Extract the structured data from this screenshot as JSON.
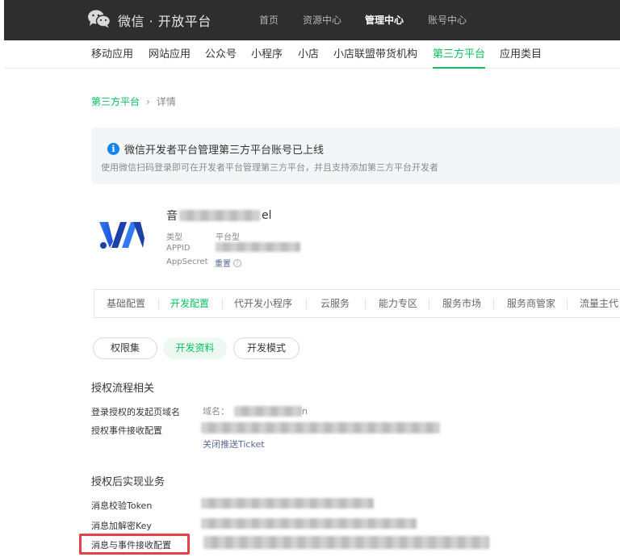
{
  "header": {
    "brand": "微信 · 开放平台",
    "nav": [
      "首页",
      "资源中心",
      "管理中心",
      "账号中心"
    ],
    "active_nav": "管理中心"
  },
  "subnav": {
    "items": [
      "移动应用",
      "网站应用",
      "公众号",
      "小程序",
      "小店",
      "小店联盟带货机构",
      "第三方平台",
      "应用类目"
    ],
    "active": "第三方平台"
  },
  "breadcrumb": {
    "parent": "第三方平台",
    "separator": "›",
    "current": "详情"
  },
  "notice": {
    "title": "微信开发者平台管理第三方平台账号已上线",
    "desc": "使用微信扫码登录即可在开发者平台管理第三方平台，并且支持添加第三方平台开发者"
  },
  "account": {
    "name_first_char": "音",
    "name_last_char": "el",
    "type_label": "类型",
    "type_value": "平台型",
    "appid_label": "APPID",
    "secret_label": "AppSecret",
    "reset_label": "重置"
  },
  "tabs": {
    "items": [
      "基础配置",
      "开发配置",
      "代开发小程序",
      "云服务",
      "能力专区",
      "服务市场",
      "服务商管家",
      "流量主代"
    ],
    "active": "开发配置"
  },
  "pills": {
    "items": [
      "权限集",
      "开发资料",
      "开发模式"
    ],
    "active": "开发资料"
  },
  "auth_section": {
    "title": "授权流程相关",
    "domain_label": "登录授权的发起页域名",
    "domain_prefix": "域名：",
    "domain_suffix": "n",
    "event_label": "授权事件接收配置",
    "close_ticket": "关闭推送Ticket"
  },
  "business_section": {
    "title": "授权后实现业务",
    "token_label": "消息校验Token",
    "key_label": "消息加解密Key",
    "msg_event_label": "消息与事件接收配置"
  },
  "colors": {
    "brand_green": "#07c160",
    "info_blue": "#1485ee",
    "highlight_red": "#e3404a"
  }
}
